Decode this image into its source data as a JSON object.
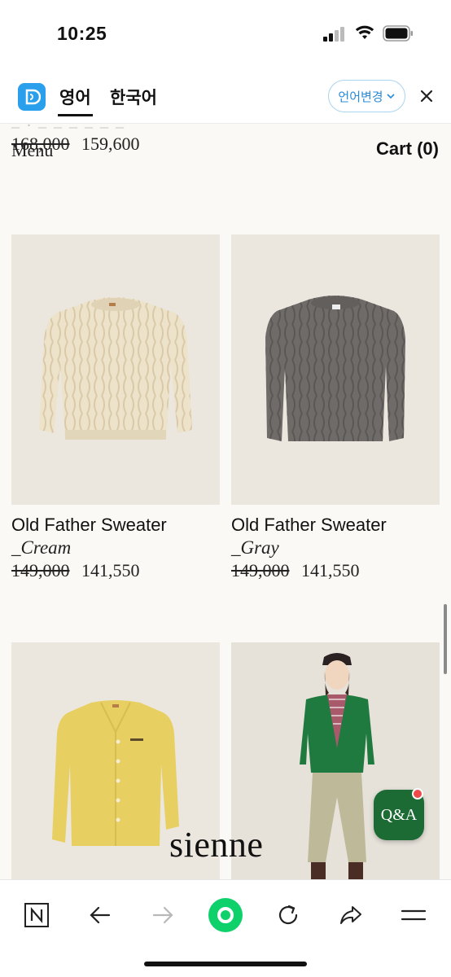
{
  "status_bar": {
    "time": "10:25"
  },
  "translate_bar": {
    "tabs": [
      {
        "label": "영어",
        "active": true
      },
      {
        "label": "한국어",
        "active": false
      }
    ],
    "change_language_label": "언어변경",
    "accent_color": "#2a8bd7"
  },
  "site_header": {
    "menu_label": "Menu",
    "cart_label": "Cart (0)"
  },
  "previous_item": {
    "faded_text": "_ . _ _ _ _ _ _",
    "original_price": "168,000",
    "sale_price": "159,600"
  },
  "products": [
    {
      "name": "Old Father Sweater",
      "variant": "_Cream",
      "original_price": "149,000",
      "sale_price": "141,550",
      "image": "cream-cable-knit-sweater"
    },
    {
      "name": "Old Father Sweater",
      "variant": "_Gray",
      "original_price": "149,000",
      "sale_price": "141,550",
      "image": "gray-cable-knit-sweater"
    },
    {
      "image": "yellow-cardigan"
    },
    {
      "image": "model-green-cardigan"
    }
  ],
  "brand": {
    "logo_text": "sienne"
  },
  "qa_button": {
    "label": "Q&A",
    "color": "#1d6b34"
  },
  "toolbar": {
    "items": [
      "naver-n-icon",
      "back-arrow-icon",
      "forward-arrow-icon",
      "green-dot-icon",
      "reload-icon",
      "share-icon",
      "menu-icon"
    ],
    "green_dot_color": "#0fd16b"
  }
}
